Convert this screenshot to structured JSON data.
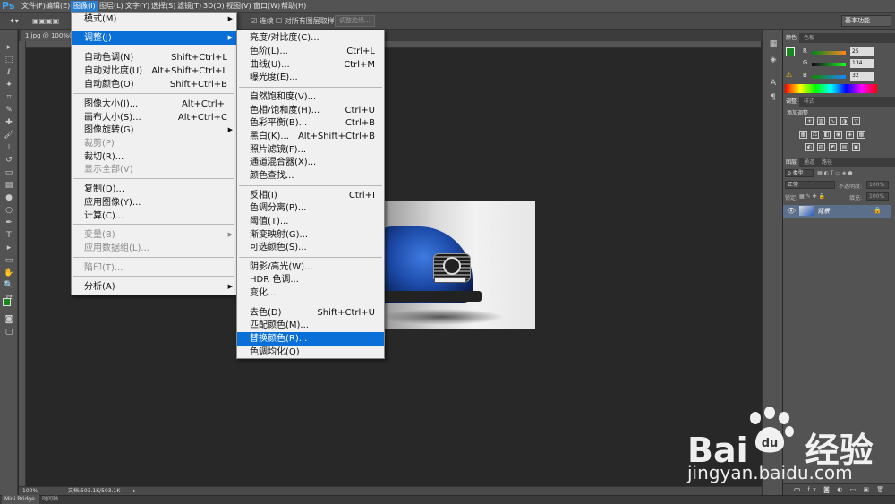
{
  "app": {
    "logo": "Ps"
  },
  "menubar": {
    "items": [
      "文件(F)",
      "编辑(E)",
      "图像(I)",
      "图层(L)",
      "文字(Y)",
      "选择(S)",
      "滤镜(T)",
      "3D(D)",
      "视图(V)",
      "窗口(W)",
      "帮助(H)"
    ],
    "active_index": 2
  },
  "options_bar": {
    "checkbox1_label": "连续",
    "checkbox2_label": "对所有图层取样",
    "refine_button": "调整边缘...",
    "workspace": "基本功能"
  },
  "document": {
    "tab_title": "1.jpg @ 100%(RGB",
    "zoom": "100%",
    "doc_info": "文档:503.1K/503.1K"
  },
  "bottom_tabs": [
    "Mini Bridge",
    "时间轴"
  ],
  "image_menu": {
    "items": [
      {
        "label": "模式(M)",
        "shortcut": "",
        "submenu": true,
        "disabled": false
      },
      {
        "label": "调整(J)",
        "shortcut": "",
        "submenu": true,
        "disabled": false,
        "highlighted": true
      },
      {
        "label": "自动色调(N)",
        "shortcut": "Shift+Ctrl+L",
        "disabled": false
      },
      {
        "label": "自动对比度(U)",
        "shortcut": "Alt+Shift+Ctrl+L",
        "disabled": false
      },
      {
        "label": "自动颜色(O)",
        "shortcut": "Shift+Ctrl+B",
        "disabled": false
      },
      {
        "label": "图像大小(I)...",
        "shortcut": "Alt+Ctrl+I",
        "disabled": false
      },
      {
        "label": "画布大小(S)...",
        "shortcut": "Alt+Ctrl+C",
        "disabled": false
      },
      {
        "label": "图像旋转(G)",
        "shortcut": "",
        "submenu": true,
        "disabled": false
      },
      {
        "label": "裁剪(P)",
        "shortcut": "",
        "disabled": true
      },
      {
        "label": "裁切(R)...",
        "shortcut": "",
        "disabled": false
      },
      {
        "label": "显示全部(V)",
        "shortcut": "",
        "disabled": true
      },
      {
        "label": "复制(D)...",
        "shortcut": "",
        "disabled": false
      },
      {
        "label": "应用图像(Y)...",
        "shortcut": "",
        "disabled": false
      },
      {
        "label": "计算(C)...",
        "shortcut": "",
        "disabled": false
      },
      {
        "label": "变量(B)",
        "shortcut": "",
        "submenu": true,
        "disabled": true
      },
      {
        "label": "应用数据组(L)...",
        "shortcut": "",
        "disabled": true
      },
      {
        "label": "陷印(T)...",
        "shortcut": "",
        "disabled": true
      },
      {
        "label": "分析(A)",
        "shortcut": "",
        "submenu": true,
        "disabled": false
      }
    ]
  },
  "adjust_submenu": {
    "items": [
      {
        "label": "亮度/对比度(C)...",
        "shortcut": ""
      },
      {
        "label": "色阶(L)...",
        "shortcut": "Ctrl+L"
      },
      {
        "label": "曲线(U)...",
        "shortcut": "Ctrl+M"
      },
      {
        "label": "曝光度(E)...",
        "shortcut": ""
      },
      {
        "label": "自然饱和度(V)...",
        "shortcut": ""
      },
      {
        "label": "色相/饱和度(H)...",
        "shortcut": "Ctrl+U"
      },
      {
        "label": "色彩平衡(B)...",
        "shortcut": "Ctrl+B"
      },
      {
        "label": "黑白(K)...",
        "shortcut": "Alt+Shift+Ctrl+B"
      },
      {
        "label": "照片滤镜(F)...",
        "shortcut": ""
      },
      {
        "label": "通道混合器(X)...",
        "shortcut": ""
      },
      {
        "label": "颜色查找...",
        "shortcut": ""
      },
      {
        "label": "反相(I)",
        "shortcut": "Ctrl+I"
      },
      {
        "label": "色调分离(P)...",
        "shortcut": ""
      },
      {
        "label": "阈值(T)...",
        "shortcut": ""
      },
      {
        "label": "渐变映射(G)...",
        "shortcut": ""
      },
      {
        "label": "可选颜色(S)...",
        "shortcut": ""
      },
      {
        "label": "阴影/高光(W)...",
        "shortcut": ""
      },
      {
        "label": "HDR 色调...",
        "shortcut": ""
      },
      {
        "label": "变化...",
        "shortcut": ""
      },
      {
        "label": "去色(D)",
        "shortcut": "Shift+Ctrl+U"
      },
      {
        "label": "匹配颜色(M)...",
        "shortcut": ""
      },
      {
        "label": "替换颜色(R)...",
        "shortcut": "",
        "highlighted": true
      },
      {
        "label": "色调均化(Q)",
        "shortcut": ""
      }
    ]
  },
  "color_panel": {
    "tabs": [
      "颜色",
      "色板"
    ],
    "r_label": "R",
    "g_label": "G",
    "b_label": "B",
    "r": "25",
    "g": "134",
    "b": "32",
    "foreground": "#198620"
  },
  "adjust_panel": {
    "tabs": [
      "调整",
      "样式"
    ],
    "title": "添加调整"
  },
  "layers_panel": {
    "tabs": [
      "图层",
      "通道",
      "路径"
    ],
    "kind_filter": "p 类型",
    "blend_mode": "正常",
    "opacity_label": "不透明度:",
    "opacity": "100%",
    "lock_label": "锁定:",
    "fill_label": "填充:",
    "fill": "100%",
    "layer_name": "背景"
  },
  "watermark": {
    "brand": "Bai",
    "brand2": "经验",
    "url": "jingyan.baidu.com"
  }
}
